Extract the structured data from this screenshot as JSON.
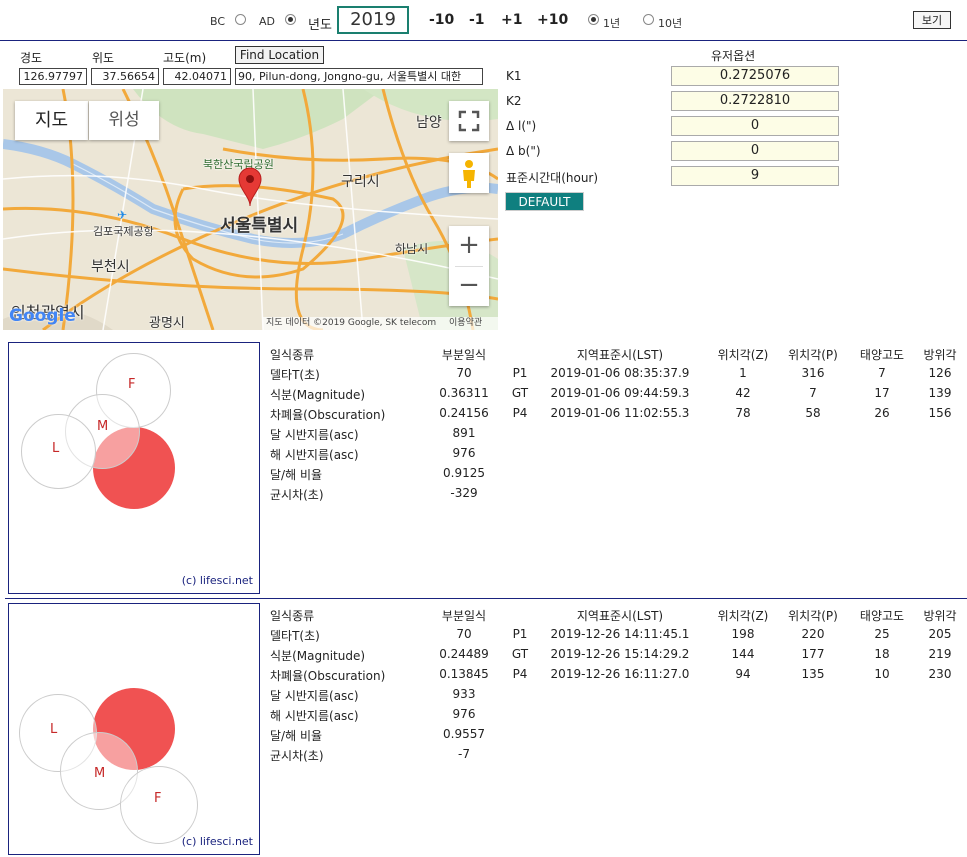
{
  "topbar": {
    "bc_label": "BC",
    "ad_label": "AD",
    "year_label": "년도",
    "year_value": "2019",
    "steps": [
      "-10",
      "-1",
      "+1",
      "+10"
    ],
    "range_1": "1년",
    "range_10": "10년",
    "view_label": "보기"
  },
  "location": {
    "lon_label": "경도",
    "lat_label": "위도",
    "alt_label": "고도(m)",
    "find_label": "Find Location",
    "lon_value": "126.97797",
    "lat_value": "37.56654",
    "alt_value": "42.04071",
    "address": "90, Pilun-dong, Jongno-gu, 서울특별시 대한"
  },
  "map": {
    "tab_map": "지도",
    "tab_satellite": "위성",
    "labels": {
      "namyang": "남양",
      "bukhansan": "북한산국립공원",
      "guri": "구리시",
      "seoul": "서울특별시",
      "gimpo": "김포국제공항",
      "hanam": "하남시",
      "bucheon": "부천시",
      "incheon": "인천광역시",
      "gwangmyeong": "광명시"
    },
    "attribution": "지도 데이터 ©2019 Google, SK telecom",
    "terms": "이용약관",
    "google": "Google",
    "zoom_in": "+",
    "zoom_out": "−"
  },
  "options": {
    "title": "유저옵션",
    "items": [
      {
        "label": "K1",
        "value": "0.2725076"
      },
      {
        "label": "K2",
        "value": "0.2722810"
      },
      {
        "label": "Δ l(\")",
        "value": "0"
      },
      {
        "label": "Δ b(\")",
        "value": "0"
      },
      {
        "label": "표준시간대(hour)",
        "value": "9"
      }
    ],
    "default_label": "DEFAULT"
  },
  "eclipses": [
    {
      "copyright": "(c) lifesci.net",
      "circle_labels": {
        "L": "L",
        "M": "M",
        "F": "F"
      },
      "type_header": "일식종류",
      "type_value": "부분일식",
      "rows": [
        {
          "label": "델타T(초)",
          "value": "70"
        },
        {
          "label": "식분(Magnitude)",
          "value": "0.36311"
        },
        {
          "label": "차폐율(Obscuration)",
          "value": "0.24156"
        },
        {
          "label": "달 시반지름(asc)",
          "value": "891"
        },
        {
          "label": "해 시반지름(asc)",
          "value": "976"
        },
        {
          "label": "달/해 비율",
          "value": "0.9125"
        },
        {
          "label": "균시차(초)",
          "value": "-329"
        }
      ],
      "headers": [
        "지역표준시(LST)",
        "위치각(Z)",
        "위치각(P)",
        "태양고도",
        "방위각"
      ],
      "contacts": [
        {
          "name": "P1",
          "lst": "2019-01-06 08:35:37.9",
          "z": "1",
          "p": "316",
          "alt": "7",
          "az": "126"
        },
        {
          "name": "GT",
          "lst": "2019-01-06 09:44:59.3",
          "z": "42",
          "p": "7",
          "alt": "17",
          "az": "139"
        },
        {
          "name": "P4",
          "lst": "2019-01-06 11:02:55.3",
          "z": "78",
          "p": "58",
          "alt": "26",
          "az": "156"
        }
      ]
    },
    {
      "copyright": "(c) lifesci.net",
      "circle_labels": {
        "L": "L",
        "M": "M",
        "F": "F"
      },
      "type_header": "일식종류",
      "type_value": "부분일식",
      "rows": [
        {
          "label": "델타T(초)",
          "value": "70"
        },
        {
          "label": "식분(Magnitude)",
          "value": "0.24489"
        },
        {
          "label": "차폐율(Obscuration)",
          "value": "0.13845"
        },
        {
          "label": "달 시반지름(asc)",
          "value": "933"
        },
        {
          "label": "해 시반지름(asc)",
          "value": "976"
        },
        {
          "label": "달/해 비율",
          "value": "0.9557"
        },
        {
          "label": "균시차(초)",
          "value": "-7"
        }
      ],
      "headers": [
        "지역표준시(LST)",
        "위치각(Z)",
        "위치각(P)",
        "태양고도",
        "방위각"
      ],
      "contacts": [
        {
          "name": "P1",
          "lst": "2019-12-26 14:11:45.1",
          "z": "198",
          "p": "220",
          "alt": "25",
          "az": "205"
        },
        {
          "name": "GT",
          "lst": "2019-12-26 15:14:29.2",
          "z": "144",
          "p": "177",
          "alt": "18",
          "az": "219"
        },
        {
          "name": "P4",
          "lst": "2019-12-26 16:11:27.0",
          "z": "94",
          "p": "135",
          "alt": "10",
          "az": "230"
        }
      ]
    }
  ],
  "colors": {
    "sun": "#f05252",
    "accent": "#1a237e",
    "teal": "#0f7f7f"
  }
}
